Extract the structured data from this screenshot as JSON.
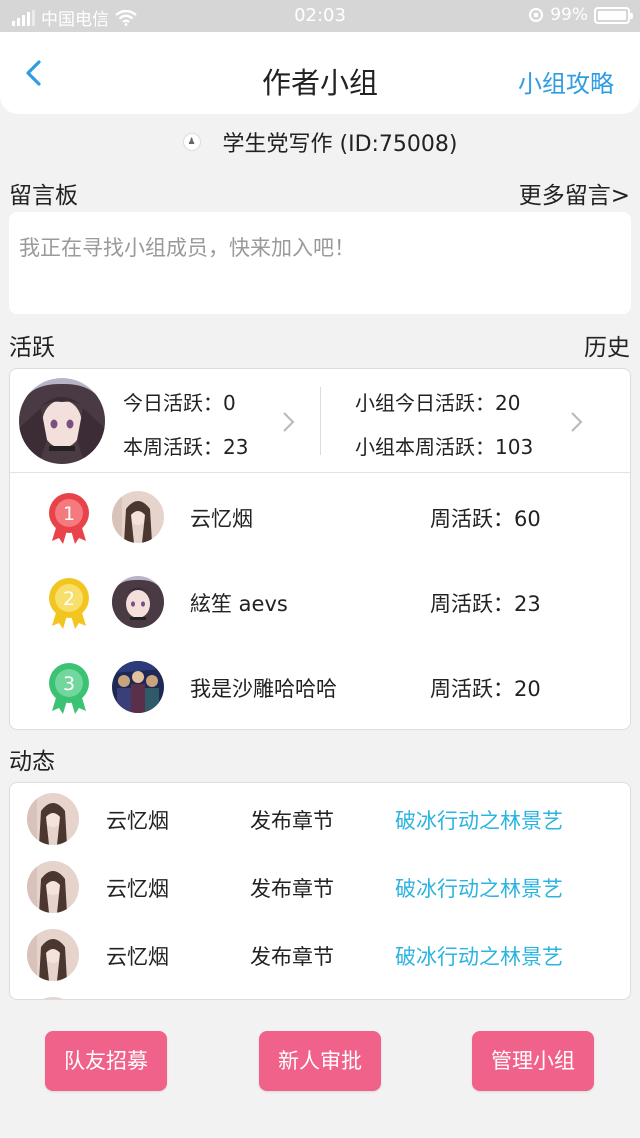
{
  "status_bar": {
    "carrier": "中国电信",
    "time": "02:03",
    "battery_percent": "99%"
  },
  "nav": {
    "title": "作者小组",
    "right_link": "小组攻略"
  },
  "group": {
    "name_id": "学生党写作 (ID:75008)"
  },
  "message_board": {
    "title": "留言板",
    "more_link": "更多留言>",
    "placeholder_text": "我正在寻找小组成员，快来加入吧！"
  },
  "activity": {
    "title": "活跃",
    "history_link": "历史",
    "mine": {
      "today": "今日活跃：0",
      "week": "本周活跃：23",
      "group_today": "小组今日活跃：20",
      "group_week": "小组本周活跃：103"
    },
    "ranking": [
      {
        "rank": "1",
        "name": "云忆烟",
        "week": "周活跃：60",
        "medal_color": "#e8434a"
      },
      {
        "rank": "2",
        "name": "絃笙 aevs",
        "week": "周活跃：23",
        "medal_color": "#f2c51f"
      },
      {
        "rank": "3",
        "name": "我是沙雕哈哈哈",
        "week": "周活跃：20",
        "medal_color": "#3cc275"
      }
    ]
  },
  "feed": {
    "title": "动态",
    "items": [
      {
        "name": "云忆烟",
        "action": "发布章节",
        "work": "破冰行动之林景艺"
      },
      {
        "name": "云忆烟",
        "action": "发布章节",
        "work": "破冰行动之林景艺"
      },
      {
        "name": "云忆烟",
        "action": "发布章节",
        "work": "破冰行动之林景艺"
      }
    ]
  },
  "buttons": {
    "recruit": "队友招募",
    "review": "新人审批",
    "manage": "管理小组"
  },
  "colors": {
    "accent_blue": "#2f9de3",
    "link_cyan": "#2bb4e0",
    "button_pink": "#f1628a"
  }
}
